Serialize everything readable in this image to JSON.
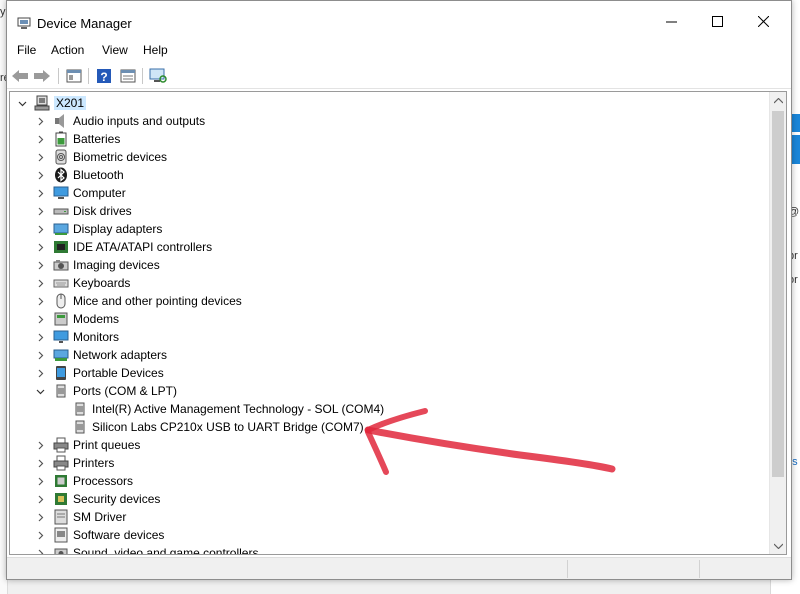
{
  "background": {
    "texts": [
      "y",
      "re",
      "@",
      "pr",
      "or",
      "ns"
    ]
  },
  "window": {
    "title": "Device Manager",
    "controls": {
      "minimize": "—",
      "maximize": "☐",
      "close": "✕"
    }
  },
  "menu": [
    "File",
    "Action",
    "View",
    "Help"
  ],
  "toolbar": [
    {
      "name": "back-icon"
    },
    {
      "name": "forward-icon"
    },
    {
      "name": "properties-pane-icon"
    },
    {
      "name": "help-icon"
    },
    {
      "name": "details-pane-icon"
    },
    {
      "name": "scan-hardware-icon"
    }
  ],
  "tree": {
    "root": {
      "label": "X201",
      "expanded": true
    },
    "categories": [
      {
        "label": "Audio inputs and outputs",
        "icon": "speaker-icon"
      },
      {
        "label": "Batteries",
        "icon": "battery-icon"
      },
      {
        "label": "Biometric devices",
        "icon": "fingerprint-icon"
      },
      {
        "label": "Bluetooth",
        "icon": "bluetooth-icon"
      },
      {
        "label": "Computer",
        "icon": "computer-icon"
      },
      {
        "label": "Disk drives",
        "icon": "disk-drive-icon"
      },
      {
        "label": "Display adapters",
        "icon": "display-adapter-icon"
      },
      {
        "label": "IDE ATA/ATAPI controllers",
        "icon": "ide-controller-icon"
      },
      {
        "label": "Imaging devices",
        "icon": "camera-icon"
      },
      {
        "label": "Keyboards",
        "icon": "keyboard-icon"
      },
      {
        "label": "Mice and other pointing devices",
        "icon": "mouse-icon"
      },
      {
        "label": "Modems",
        "icon": "modem-icon"
      },
      {
        "label": "Monitors",
        "icon": "monitor-icon"
      },
      {
        "label": "Network adapters",
        "icon": "network-adapter-icon"
      },
      {
        "label": "Portable Devices",
        "icon": "portable-device-icon"
      },
      {
        "label": "Ports (COM & LPT)",
        "icon": "port-icon",
        "expanded": true,
        "children": [
          {
            "label": "Intel(R) Active Management Technology - SOL (COM4)",
            "icon": "port-icon"
          },
          {
            "label": "Silicon Labs CP210x USB to UART Bridge (COM7)",
            "icon": "port-icon"
          }
        ]
      },
      {
        "label": "Print queues",
        "icon": "printer-icon"
      },
      {
        "label": "Printers",
        "icon": "printer-icon"
      },
      {
        "label": "Processors",
        "icon": "processor-icon"
      },
      {
        "label": "Security devices",
        "icon": "security-device-icon"
      },
      {
        "label": "SM Driver",
        "icon": "driver-icon"
      },
      {
        "label": "Software devices",
        "icon": "software-device-icon"
      },
      {
        "label": "Sound, video and game controllers",
        "icon": "sound-icon"
      }
    ]
  },
  "annotation": {
    "color": "#e0283c"
  },
  "colors": {
    "selection": "#cce8ff",
    "accent": "#1a86d9"
  }
}
